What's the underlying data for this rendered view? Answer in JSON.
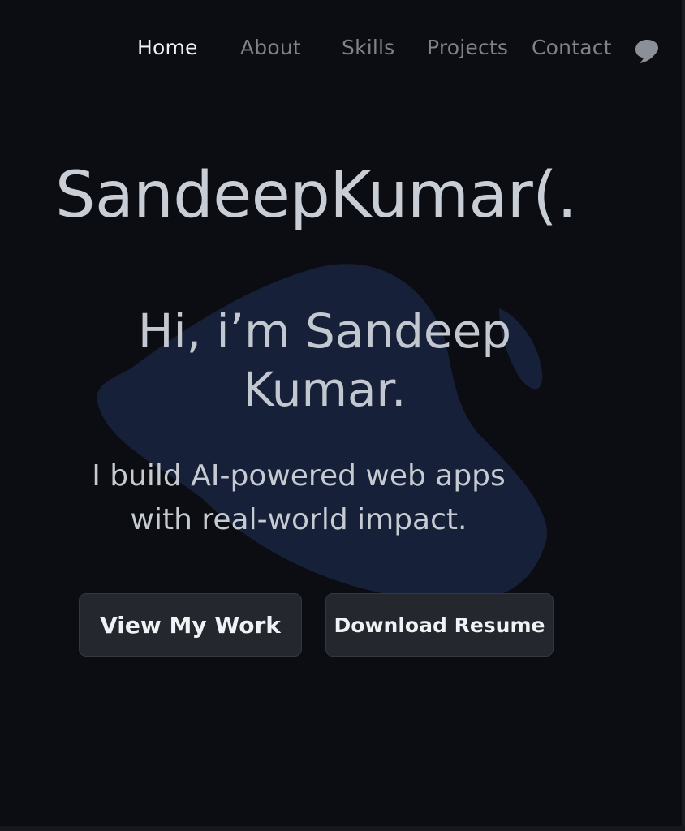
{
  "nav": {
    "items": [
      {
        "label": "Home",
        "active": true
      },
      {
        "label": "About",
        "active": false
      },
      {
        "label": "Skills",
        "active": false
      },
      {
        "label": "Projects",
        "active": false
      },
      {
        "label": "Contact",
        "active": false
      }
    ],
    "theme_toggle_icon": "theme-toggle-icon"
  },
  "hero": {
    "name_title": "SandeepKumar(.",
    "greeting_line1": "Hi, i’m Sandeep",
    "greeting_line2": "Kumar.",
    "tagline_line1": "I build AI-powered web apps",
    "tagline_line2": "with real-world impact.",
    "primary_button": "View My Work",
    "secondary_button": "Download Resume"
  },
  "colors": {
    "background": "#0b0d12",
    "blob": "#162038",
    "text_primary": "#eef0f3",
    "text_muted": "#7d828b",
    "button_bg": "#24272d"
  }
}
